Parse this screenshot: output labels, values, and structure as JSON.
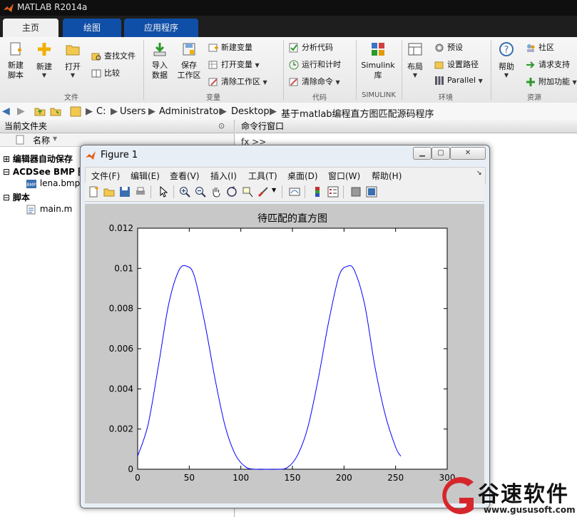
{
  "app": {
    "title": "MATLAB R2014a",
    "tabs": [
      {
        "label": "主页",
        "active": true
      },
      {
        "label": "绘图",
        "active": false
      },
      {
        "label": "应用程序",
        "active": false
      }
    ]
  },
  "ribbon": {
    "file_group": {
      "label": "文件",
      "new_script": "新建\n脚本",
      "new": "新建",
      "open": "打开",
      "find_files": "查找文件",
      "compare": "比较"
    },
    "variable_group": {
      "label": "变量",
      "import_data": "导入\n数据",
      "save_workspace": "保存\n工作区",
      "new_variable": "新建变量",
      "open_variable": "打开变量",
      "clear_workspace": "清除工作区"
    },
    "code_group": {
      "label": "代码",
      "analyze_code": "分析代码",
      "run_and_time": "运行和计时",
      "clear_commands": "清除命令"
    },
    "simulink_group": {
      "label": "SIMULINK",
      "simulink_library": "Simulink\n库"
    },
    "environment_group": {
      "label": "环境",
      "layout": "布局",
      "preferences": "预设",
      "set_path": "设置路径",
      "parallel": "Parallel"
    },
    "resources_group": {
      "label": "资源",
      "help": "帮助",
      "community": "社区",
      "request_support": "请求支持",
      "add_ons": "附加功能"
    }
  },
  "address": {
    "crumbs": [
      "C:",
      "Users",
      "Administrator",
      "Desktop",
      "基于matlab编程直方图匹配源码程序"
    ]
  },
  "current_folder": {
    "title": "当前文件夹",
    "column_name": "名称",
    "tree": [
      {
        "label": "编辑器自动保存",
        "bold": true,
        "expander": "⊞"
      },
      {
        "label": "ACDSee BMP 图",
        "bold": true,
        "expander": "⊟"
      },
      {
        "label": "lena.bmp",
        "bold": false,
        "icon": "bmp-file-icon"
      },
      {
        "label": "脚本",
        "bold": true,
        "expander": "⊟"
      },
      {
        "label": "main.m",
        "bold": false,
        "icon": "m-file-icon"
      }
    ]
  },
  "command_window": {
    "title": "命令行窗口",
    "prompt": "fx >>"
  },
  "figure": {
    "title": "Figure 1",
    "menu": [
      "文件(F)",
      "编辑(E)",
      "查看(V)",
      "插入(I)",
      "工具(T)",
      "桌面(D)",
      "窗口(W)",
      "帮助(H)"
    ]
  },
  "chart_data": {
    "type": "line",
    "title": "待匹配的直方图",
    "xlabel": "",
    "ylabel": "",
    "xlim": [
      0,
      300
    ],
    "ylim": [
      0,
      0.012
    ],
    "xticks": [
      0,
      50,
      100,
      150,
      200,
      250,
      300
    ],
    "yticks": [
      0,
      0.002,
      0.004,
      0.006,
      0.008,
      0.01,
      0.012
    ],
    "yticklabels": [
      "0",
      "0.002",
      "0.004",
      "0.006",
      "0.008",
      "0.01",
      "0.012"
    ],
    "grid": false,
    "series": [
      {
        "color": "#0000ff",
        "x": [
          0,
          10,
          20,
          30,
          40,
          48,
          55,
          65,
          75,
          85,
          95,
          105,
          115,
          125,
          135,
          145,
          155,
          165,
          175,
          185,
          195,
          203,
          210,
          220,
          230,
          240,
          250,
          255
        ],
        "y": [
          0.00065,
          0.0022,
          0.0051,
          0.0082,
          0.0099,
          0.0101,
          0.0096,
          0.0073,
          0.0045,
          0.0021,
          0.0007,
          0.0001,
          0.0,
          0.0,
          0.0,
          8e-05,
          0.0007,
          0.0021,
          0.0045,
          0.0073,
          0.0096,
          0.0101,
          0.0099,
          0.0082,
          0.0051,
          0.0027,
          0.0011,
          0.00065
        ]
      }
    ]
  },
  "watermark": {
    "brand": "谷速软件",
    "url": "www.gususoft.com"
  },
  "colors": {
    "tab_blue": "#0f4fa8",
    "plot_line": "#0000ff",
    "watermark_red": "#d6262c"
  }
}
